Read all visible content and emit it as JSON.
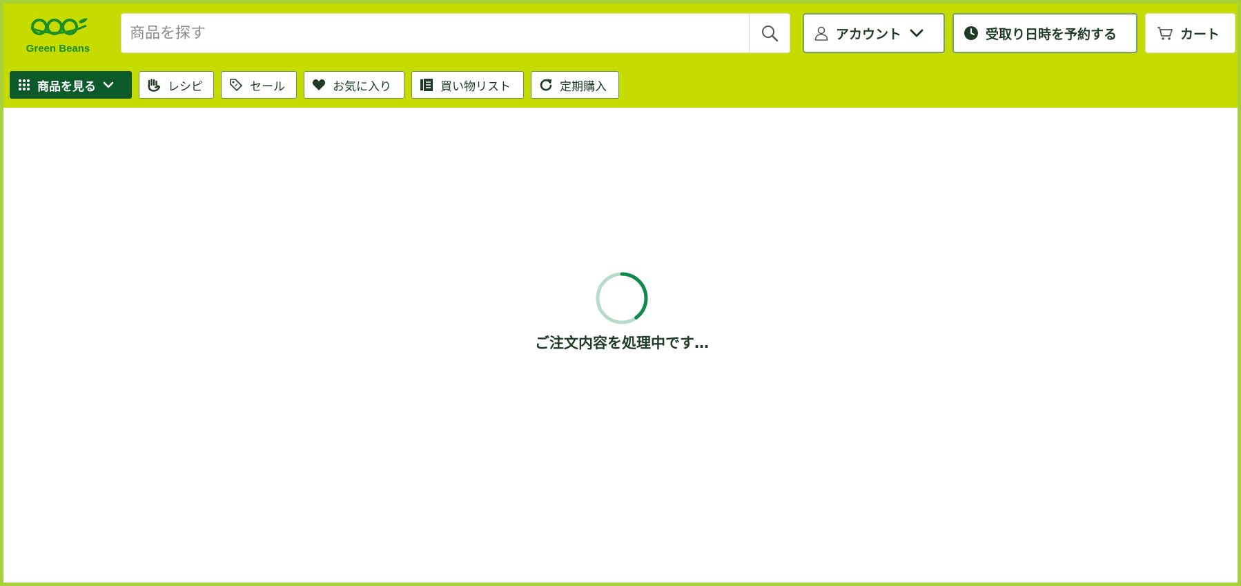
{
  "logo": {
    "text": "Green Beans",
    "color": "#1b8e28"
  },
  "search": {
    "placeholder": "商品を探す",
    "value": "",
    "icon": "search-icon"
  },
  "header": {
    "account_label": "アカウント",
    "reserve_label": "受取り日時を予約する",
    "cart_label": "カート"
  },
  "nav": {
    "items": [
      {
        "label": "商品を見る",
        "icon": "grid-icon"
      },
      {
        "label": "レシピ",
        "icon": "hand-icon"
      },
      {
        "label": "セール",
        "icon": "tag-icon"
      },
      {
        "label": "お気に入り",
        "icon": "heart-icon"
      },
      {
        "label": "買い物リスト",
        "icon": "list-icon"
      },
      {
        "label": "定期購入",
        "icon": "refresh-icon"
      }
    ]
  },
  "status": {
    "loading_text": "ご注文内容を処理中です…"
  },
  "colors": {
    "header_bg": "#c6dc00",
    "primary_green": "#0c5a2a",
    "spinner_track": "#b5dcc8",
    "spinner_arc": "#0e8a4a",
    "frame_border": "#a6d13a"
  }
}
